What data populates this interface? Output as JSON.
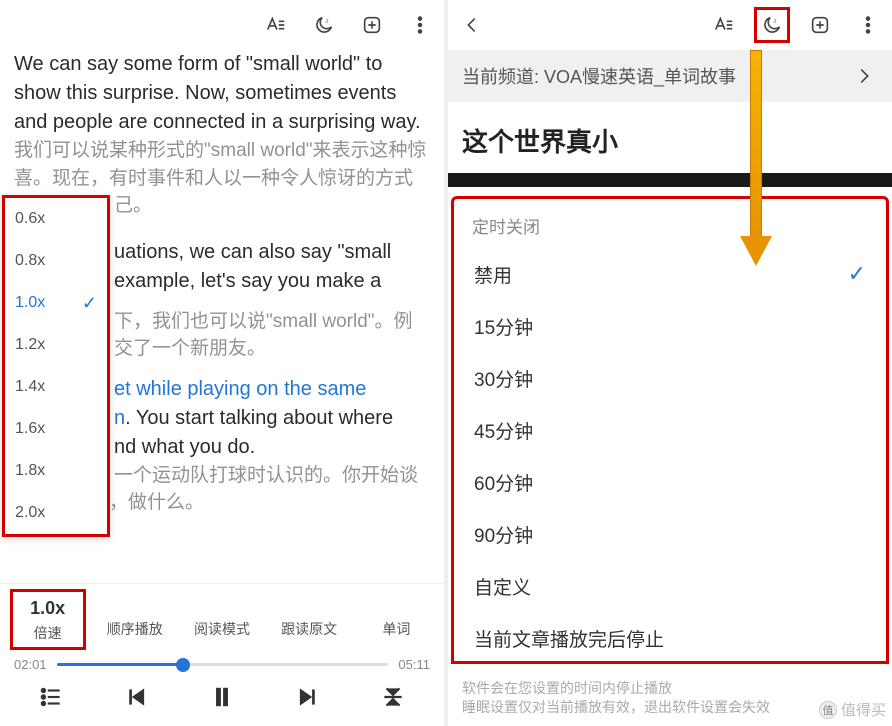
{
  "left": {
    "topbar_icons": [
      "font-icon",
      "moon-icon",
      "add-icon",
      "more-icon"
    ],
    "article": {
      "p1_en": "We can say some form of \"small world\" to show this surprise. Now, sometimes events and people are connected in a surprising way.",
      "p1_zh": "我们可以说某种形式的\"small world\"来表示这种惊喜。现在，有时事件和人以一种令人惊讶的方式",
      "p1_zh_tail": "己。",
      "p2_en_a": "uations, we can also say \"small",
      "p2_en_b": "example, let's say you make a",
      "p2_zh_a": "下，我们也可以说\"small world\"。例",
      "p2_zh_b": "交了一个新朋友。",
      "p3_link": "et while playing on the same",
      "p3_en_a": ". You start talking about where",
      "p3_en_b": "nd what you do. ",
      "p3_zh_a": "一个运动队打球时认识的。你开始谈",
      "p3_zh_b": "论住在哪里，做什么。"
    },
    "speed_options": [
      "0.6x",
      "0.8x",
      "1.0x",
      "1.2x",
      "1.4x",
      "1.6x",
      "1.8x",
      "2.0x"
    ],
    "speed_selected": "1.0x",
    "toolbar": {
      "speed_value": "1.0x",
      "speed_label": "倍速",
      "order_label": "顺序播放",
      "read_label": "阅读模式",
      "follow_label": "跟读原文",
      "word_label": "单词"
    },
    "progress": {
      "current": "02:01",
      "total": "05:11",
      "percent": 38
    }
  },
  "right": {
    "channel_prefix": "当前频道: ",
    "channel_name": "VOA慢速英语_单词故事",
    "title": "这个世界真小",
    "sheet": {
      "title": "定时关闭",
      "items": [
        "禁用",
        "15分钟",
        "30分钟",
        "45分钟",
        "60分钟",
        "90分钟",
        "自定义",
        "当前文章播放完后停止"
      ],
      "selected": "禁用"
    },
    "footer": {
      "l1": "软件会在您设置的时间内停止播放",
      "l2": "睡眠设置仅对当前播放有效，退出软件设置会失效"
    }
  },
  "watermark": "值得买"
}
